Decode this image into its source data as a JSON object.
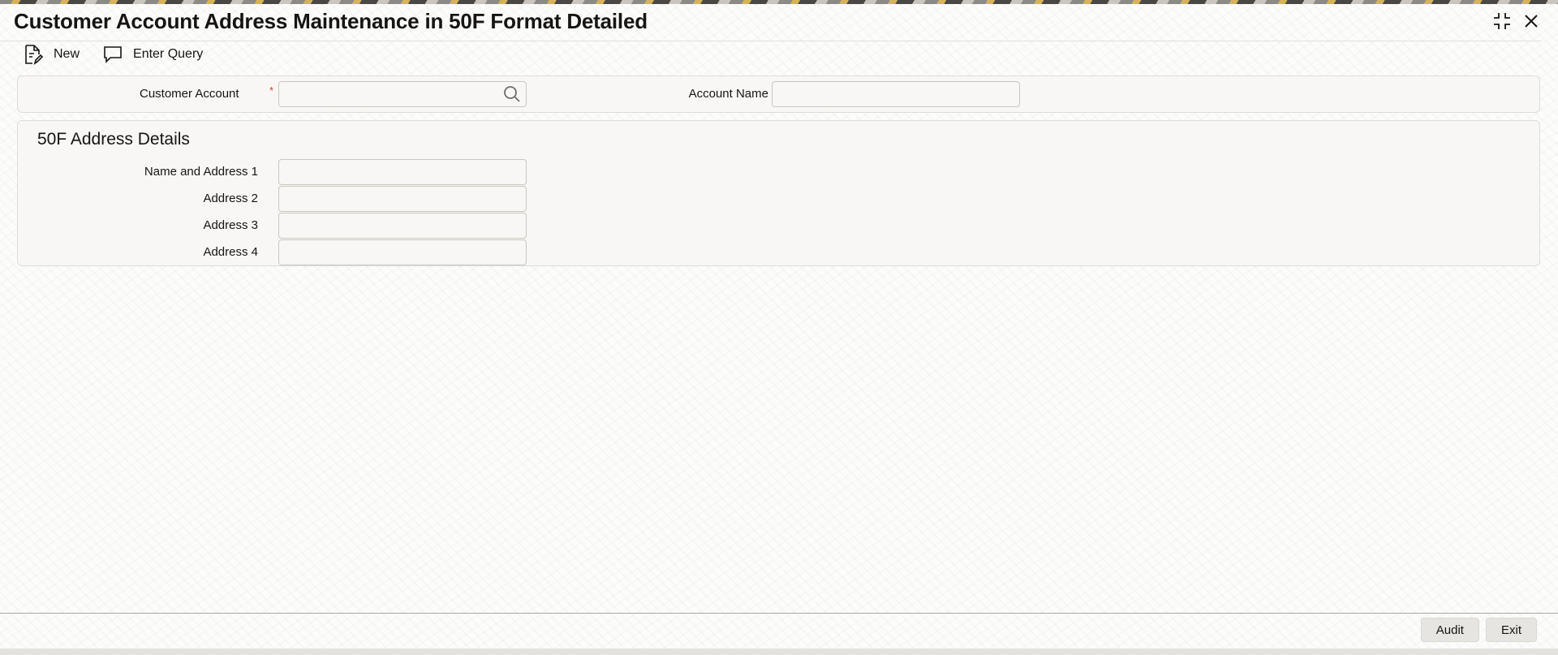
{
  "window": {
    "title": "Customer Account Address Maintenance in 50F Format Detailed"
  },
  "icons": {
    "new": "new-document-icon",
    "enter_query": "speech-bubble-icon",
    "maximize": "maximize-icon",
    "close": "close-icon",
    "search": "search-icon"
  },
  "toolbar": {
    "new_label": "New",
    "enter_query_label": "Enter Query"
  },
  "header_fields": {
    "customer_account_label": "Customer Account",
    "customer_account_required": "*",
    "customer_account_value": "",
    "account_name_label": "Account Name",
    "account_name_value": ""
  },
  "address_section": {
    "title": "50F Address Details",
    "rows": [
      {
        "label": "Name and Address 1",
        "value": ""
      },
      {
        "label": "Address 2",
        "value": ""
      },
      {
        "label": "Address 3",
        "value": ""
      },
      {
        "label": "Address 4",
        "value": ""
      }
    ]
  },
  "footer": {
    "audit_label": "Audit",
    "exit_label": "Exit"
  },
  "colors": {
    "required_mark": "#c74634",
    "text": "#161513",
    "panel_background": "#f8f7f5"
  }
}
